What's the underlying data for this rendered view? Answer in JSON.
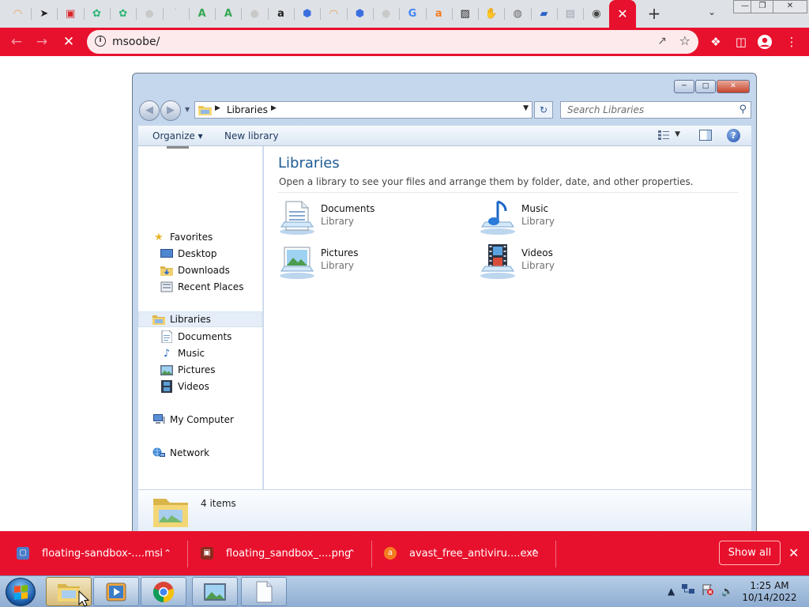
{
  "browser": {
    "tabs": [
      {
        "icon": "rainbow-icon",
        "color": "#e8a24a"
      },
      {
        "icon": "cursor-arrow-icon",
        "color": "#222222"
      },
      {
        "icon": "red-lock-icon",
        "color": "#d9262c"
      },
      {
        "icon": "green-swirl-icon",
        "color": "#2bb673"
      },
      {
        "icon": "green-swirl-icon",
        "color": "#2bb673"
      },
      {
        "icon": "grey-circle-icon",
        "color": "#c9c9c9"
      },
      {
        "icon": "blank-tick-icon",
        "color": "#c9c9c9"
      },
      {
        "icon": "green-a-icon",
        "color": "#34a853"
      },
      {
        "icon": "green-a-icon",
        "color": "#34a853"
      },
      {
        "icon": "grey-circle-icon",
        "color": "#c9c9c9"
      },
      {
        "icon": "amazon-icon",
        "color": "#222222"
      },
      {
        "icon": "blue-hexagon-icon",
        "color": "#3b6fe0"
      },
      {
        "icon": "rainbow-icon",
        "color": "#e8a24a"
      },
      {
        "icon": "blue-hexagon-icon",
        "color": "#3b6fe0"
      },
      {
        "icon": "grey-circle-icon",
        "color": "#c9c9c9"
      },
      {
        "icon": "google-icon",
        "color": "#4285f4"
      },
      {
        "icon": "avast-icon",
        "color": "#f47c20"
      },
      {
        "icon": "striped-icon",
        "color": "#222222"
      },
      {
        "icon": "hand-icon",
        "color": "#444444"
      },
      {
        "icon": "globe-icon",
        "color": "#666666"
      },
      {
        "icon": "blue-drive-icon",
        "color": "#2b63c6"
      },
      {
        "icon": "window-icon",
        "color": "#9aa3ad"
      },
      {
        "icon": "chrome-icon",
        "color": "#444444"
      }
    ],
    "active_tab_close": "✕",
    "new_tab": "+",
    "url": "msoobe/",
    "accent": "#e8112d"
  },
  "explorer": {
    "breadcrumb": "Libraries",
    "search_placeholder": "Search Libraries",
    "commands": {
      "organize": "Organize",
      "new_library": "New library"
    },
    "nav": {
      "favorites": "Favorites",
      "desktop": "Desktop",
      "downloads": "Downloads",
      "recent_places": "Recent Places",
      "libraries": "Libraries",
      "documents": "Documents",
      "music": "Music",
      "pictures": "Pictures",
      "videos": "Videos",
      "my_computer": "My Computer",
      "network": "Network"
    },
    "content": {
      "title": "Libraries",
      "description": "Open a library to see your files and arrange them by folder, date, and other properties.",
      "libraries": [
        {
          "name": "Documents",
          "type": "Library",
          "icon": "documents-library-icon"
        },
        {
          "name": "Music",
          "type": "Library",
          "icon": "music-library-icon"
        },
        {
          "name": "Pictures",
          "type": "Library",
          "icon": "pictures-library-icon"
        },
        {
          "name": "Videos",
          "type": "Library",
          "icon": "videos-library-icon"
        }
      ]
    },
    "details": {
      "count": "4 items"
    }
  },
  "downloads": {
    "items": [
      {
        "name": "floating-sandbox-....msi",
        "icon": "msi-installer-icon"
      },
      {
        "name": "floating_sandbox_....png",
        "icon": "png-image-icon"
      },
      {
        "name": "avast_free_antiviru....exe",
        "icon": "avast-icon"
      }
    ],
    "show_all": "Show all"
  },
  "taskbar": {
    "clock_time": "1:25 AM",
    "clock_date": "10/14/2022"
  }
}
